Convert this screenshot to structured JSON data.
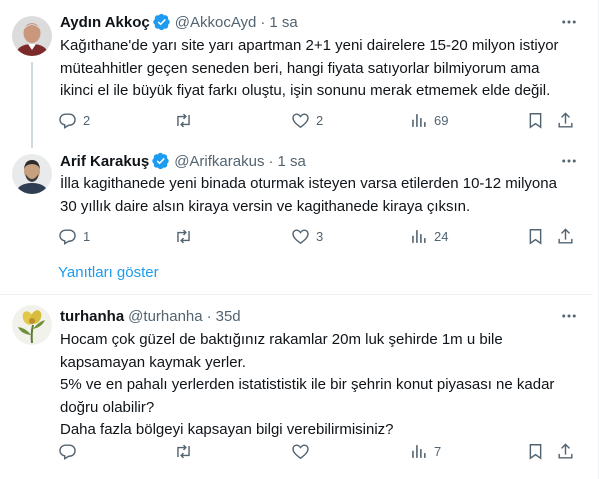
{
  "tweets": [
    {
      "name": "Aydın Akkoç",
      "handle": "@AkkocAyd",
      "separator": "·",
      "time": "1 sa",
      "verified": true,
      "text_lines": [
        "Kağıthane'de yarı site yarı apartman 2+1 yeni dairelere 15-20 milyon istiyor",
        "müteahhitler geçen seneden beri, hangi fiyata satıyorlar bilmiyorum ama",
        "ikinci el ile büyük fiyat farkı oluştu, işin sonunu merak etmemek elde değil."
      ],
      "replies": "2",
      "retweets": "",
      "likes": "2",
      "views": "69"
    },
    {
      "name": "Arif Karakuş",
      "handle": "@Arifkarakus",
      "separator": "·",
      "time": "1 sa",
      "verified": true,
      "text_lines": [
        "İlla kagithanede yeni binada oturmak isteyen varsa etilerden 10-12 milyona",
        "30 yıllık daire alsın kiraya versin ve kagithanede kiraya çıksın."
      ],
      "replies": "1",
      "retweets": "",
      "likes": "3",
      "views": "24"
    },
    {
      "name": "turhanha",
      "handle": "@turhanha",
      "separator": "·",
      "time": "35d",
      "verified": false,
      "text_lines": [
        "Hocam çok güzel de baktığınız rakamlar 20m luk şehirde 1m u bile",
        "kapsamayan kaymak yerler.",
        "5% ve en pahalı yerlerden istatististik ile bir şehrin konut piyasası ne kadar",
        "doğru olabilir?",
        "Daha fazla bölgeyi kapsayan bilgi verebilirmisiniz?"
      ],
      "replies": "",
      "retweets": "",
      "likes": "",
      "views": "7"
    }
  ],
  "show_replies_label": "Yanıtları göster",
  "colors": {
    "accent": "#1d9bf0",
    "text": "#0f1419",
    "secondary": "#536471",
    "divider": "#eff3f4"
  },
  "icons": {
    "more": "more-horizontal-icon",
    "reply": "reply-icon",
    "retweet": "retweet-icon",
    "like": "heart-icon",
    "views": "views-bars-icon",
    "bookmark": "bookmark-icon",
    "share": "share-icon",
    "verified": "verified-badge-icon"
  }
}
